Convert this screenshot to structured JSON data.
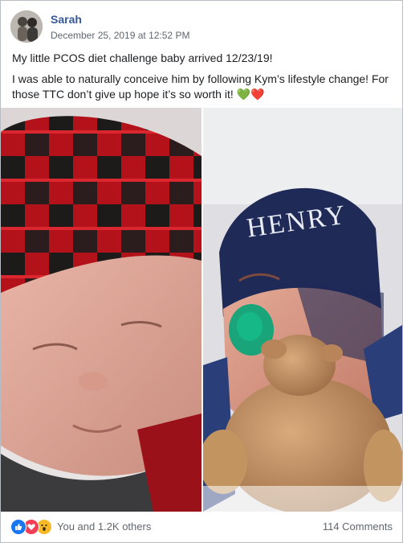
{
  "post": {
    "author": "Sarah",
    "timestamp": "December 25, 2019 at 12:52 PM",
    "paragraphs": [
      "My little PCOS diet challenge baby arrived 12/23/19!",
      "I was able to naturally conceive him by following Kym’s lifestyle change! For those TTC don’t give up hope it’s so worth it! 💚❤️"
    ],
    "photo_right_hat_text": "HENRY"
  },
  "footer": {
    "reactions": [
      "like-icon",
      "love-icon",
      "wow-icon"
    ],
    "reaction_count": "You and 1.2K others",
    "comments": "114 Comments"
  },
  "colors": {
    "author": "#365899",
    "meta": "#616770",
    "like": "#1877f2",
    "love": "#f33e58",
    "wow": "#f7b928"
  }
}
